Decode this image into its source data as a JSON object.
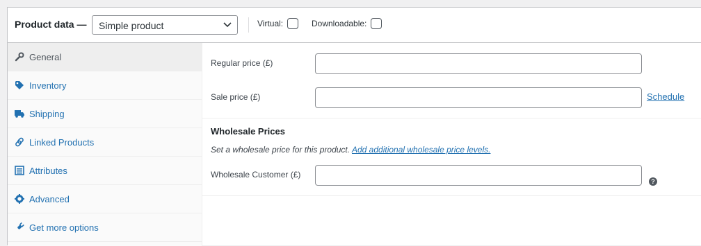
{
  "header": {
    "title": "Product data —",
    "product_type": "Simple product",
    "virtual_label": "Virtual:",
    "downloadable_label": "Downloadable:"
  },
  "tabs": [
    {
      "label": "General",
      "icon": "wrench-icon",
      "active": true
    },
    {
      "label": "Inventory",
      "icon": "tag-icon"
    },
    {
      "label": "Shipping",
      "icon": "truck-icon"
    },
    {
      "label": "Linked Products",
      "icon": "link-icon"
    },
    {
      "label": "Attributes",
      "icon": "list-icon"
    },
    {
      "label": "Advanced",
      "icon": "gear-icon"
    },
    {
      "label": "Get more options",
      "icon": "plugin-icon"
    }
  ],
  "general": {
    "regular_price_label": "Regular price (£)",
    "regular_price_value": "",
    "sale_price_label": "Sale price (£)",
    "sale_price_value": "",
    "schedule_link": "Schedule"
  },
  "wholesale": {
    "title": "Wholesale Prices",
    "description": "Set a wholesale price for this product.",
    "add_levels_link": "Add additional wholesale price levels.",
    "customer_label": "Wholesale Customer (£)",
    "customer_value": "",
    "help_glyph": "?"
  },
  "colors": {
    "link": "#2271b1",
    "border": "#c3c4c7"
  }
}
